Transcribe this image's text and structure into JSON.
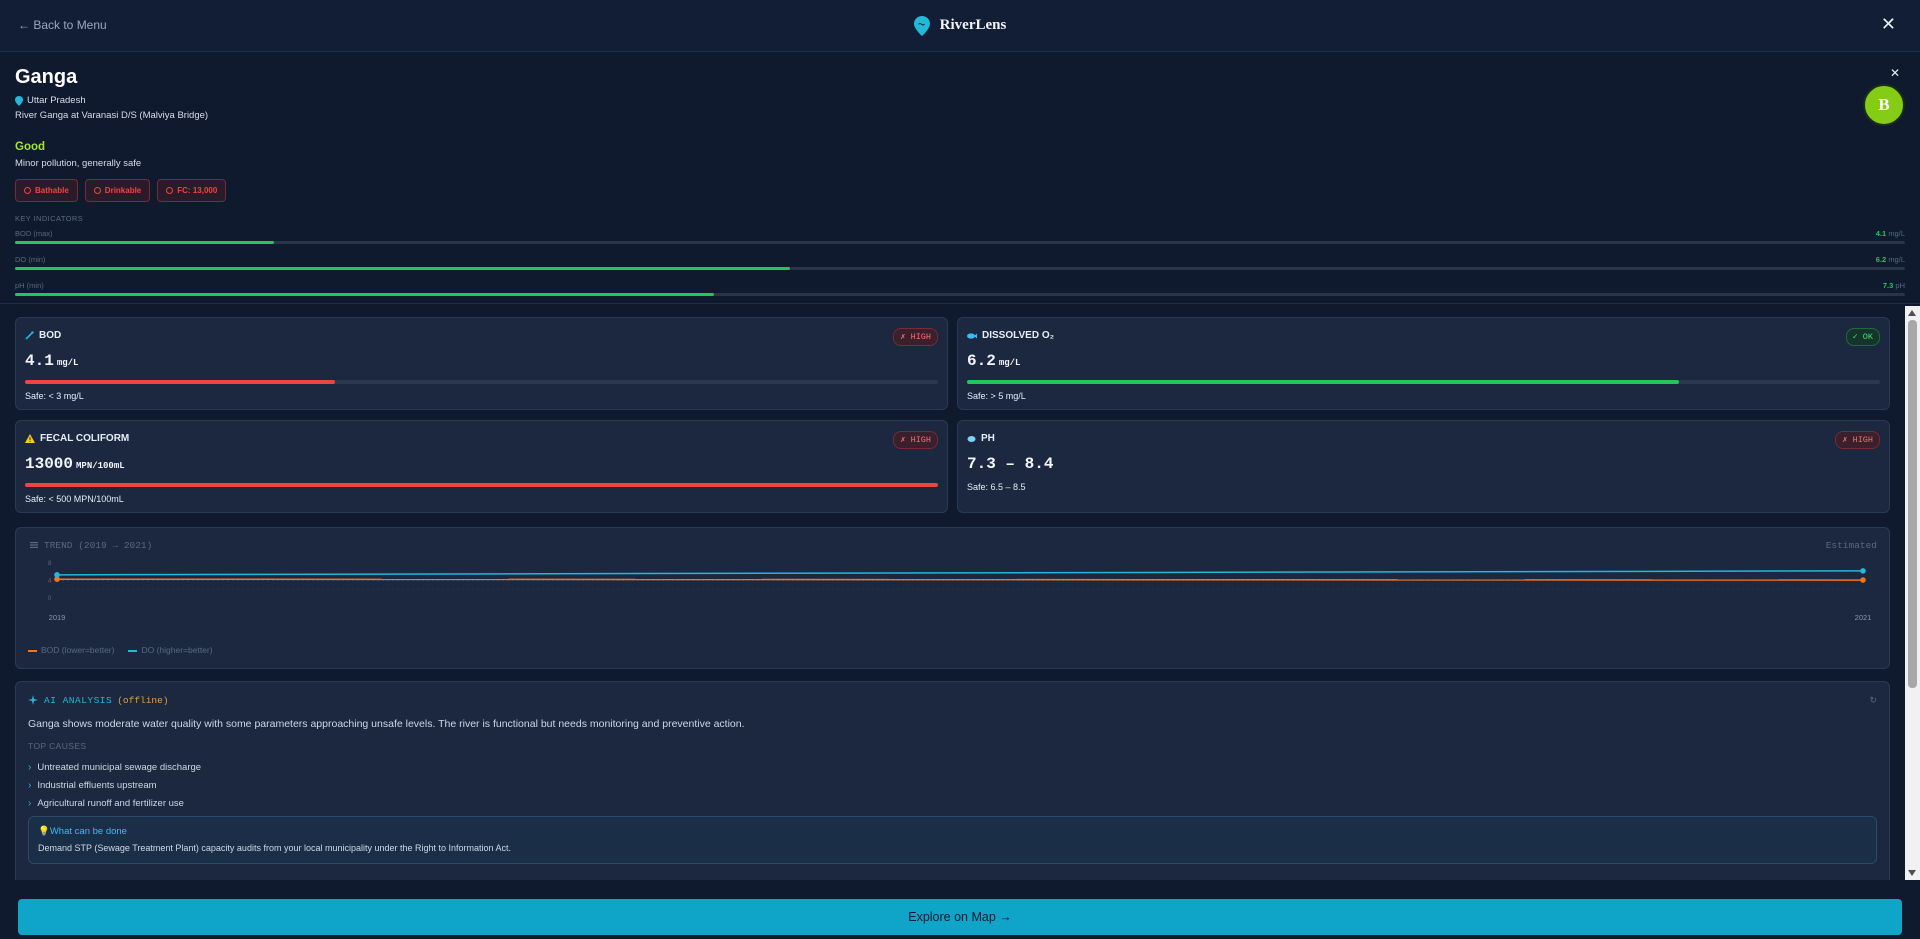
{
  "nav": {
    "back_label": "← Back to Menu",
    "brand": "RiverLens",
    "close": "✕"
  },
  "river": {
    "name": "Ganga",
    "state": "Uttar Pradesh",
    "station": "River Ganga at Varanasi D/S (Malviya Bridge)",
    "quality": "Good",
    "quality_desc": "Minor pollution, generally safe",
    "badges": [
      "Bathable",
      "Drinkable",
      "FC: 13,000"
    ]
  },
  "avatar": {
    "letter": "B",
    "close": "✕"
  },
  "key_indicators": {
    "title": "KEY INDICATORS",
    "items": [
      {
        "label": "BOD (max)",
        "value": "4.1",
        "unit": "mg/L",
        "fill": 0.137
      },
      {
        "label": "DO (min)",
        "value": "6.2",
        "unit": "mg/L",
        "fill": 0.41
      },
      {
        "label": "pH (min)",
        "value": "7.3",
        "unit": "pH",
        "fill": 0.37
      }
    ]
  },
  "cards": [
    {
      "title": "BOD",
      "icon": "flask-icon",
      "status": "✗ HIGH",
      "value": "4.1",
      "unit": "mg/L",
      "fill": 0.34,
      "color": "#ef4444",
      "safe": "Safe: < 3 mg/L"
    },
    {
      "title": "DISSOLVED O₂",
      "icon": "fish-icon",
      "status": "✓ OK",
      "value": "6.2",
      "unit": "mg/L",
      "fill": 0.78,
      "color": "#22c55e",
      "safe": "Safe: > 5 mg/L"
    },
    {
      "title": "FECAL COLIFORM",
      "icon": "warning-icon",
      "status": "✗ HIGH",
      "value": "13000",
      "unit": "MPN/100mL",
      "fill": 1.0,
      "color": "#ef4444",
      "safe": "Safe: < 500 MPN/100mL"
    },
    {
      "title": "PH",
      "icon": "drop-icon",
      "status": "✗ HIGH",
      "value": "7.3 – 8.4",
      "unit": "",
      "safe": "Safe: 6.5 – 8.5"
    }
  ],
  "trend": {
    "title": "TREND (2019 → 2021)",
    "estimated": "Estimated",
    "legend_bod": "BOD (lower=better)",
    "legend_do": "DO (higher=better)",
    "chart_data": {
      "type": "line",
      "x": [
        "2019",
        "2021"
      ],
      "yticks": [
        "8",
        "4",
        "0"
      ],
      "ylim": [
        0,
        8
      ],
      "series": [
        {
          "name": "BOD (lower=better)",
          "values": [
            4.3,
            4.1
          ],
          "color": "#f97316"
        },
        {
          "name": "DO (higher=better)",
          "values": [
            5.3,
            6.2
          ],
          "color": "#22b8d8"
        }
      ]
    }
  },
  "ai": {
    "title": "AI ANALYSIS",
    "mode": "(offline)",
    "refresh": "↻",
    "summary": "Ganga shows moderate water quality with some parameters approaching unsafe levels. The river is functional but needs monitoring and preventive action.",
    "causes_title": "TOP CAUSES",
    "causes": [
      "Untreated municipal sewage discharge",
      "Industrial effluents upstream",
      "Agricultural runoff and fertilizer use"
    ],
    "todo_title": "What can be done",
    "todo_text": "Demand STP (Sewage Treatment Plant) capacity audits from your local municipality under the Right to Information Act."
  },
  "cta": {
    "label": "Explore on Map →"
  }
}
